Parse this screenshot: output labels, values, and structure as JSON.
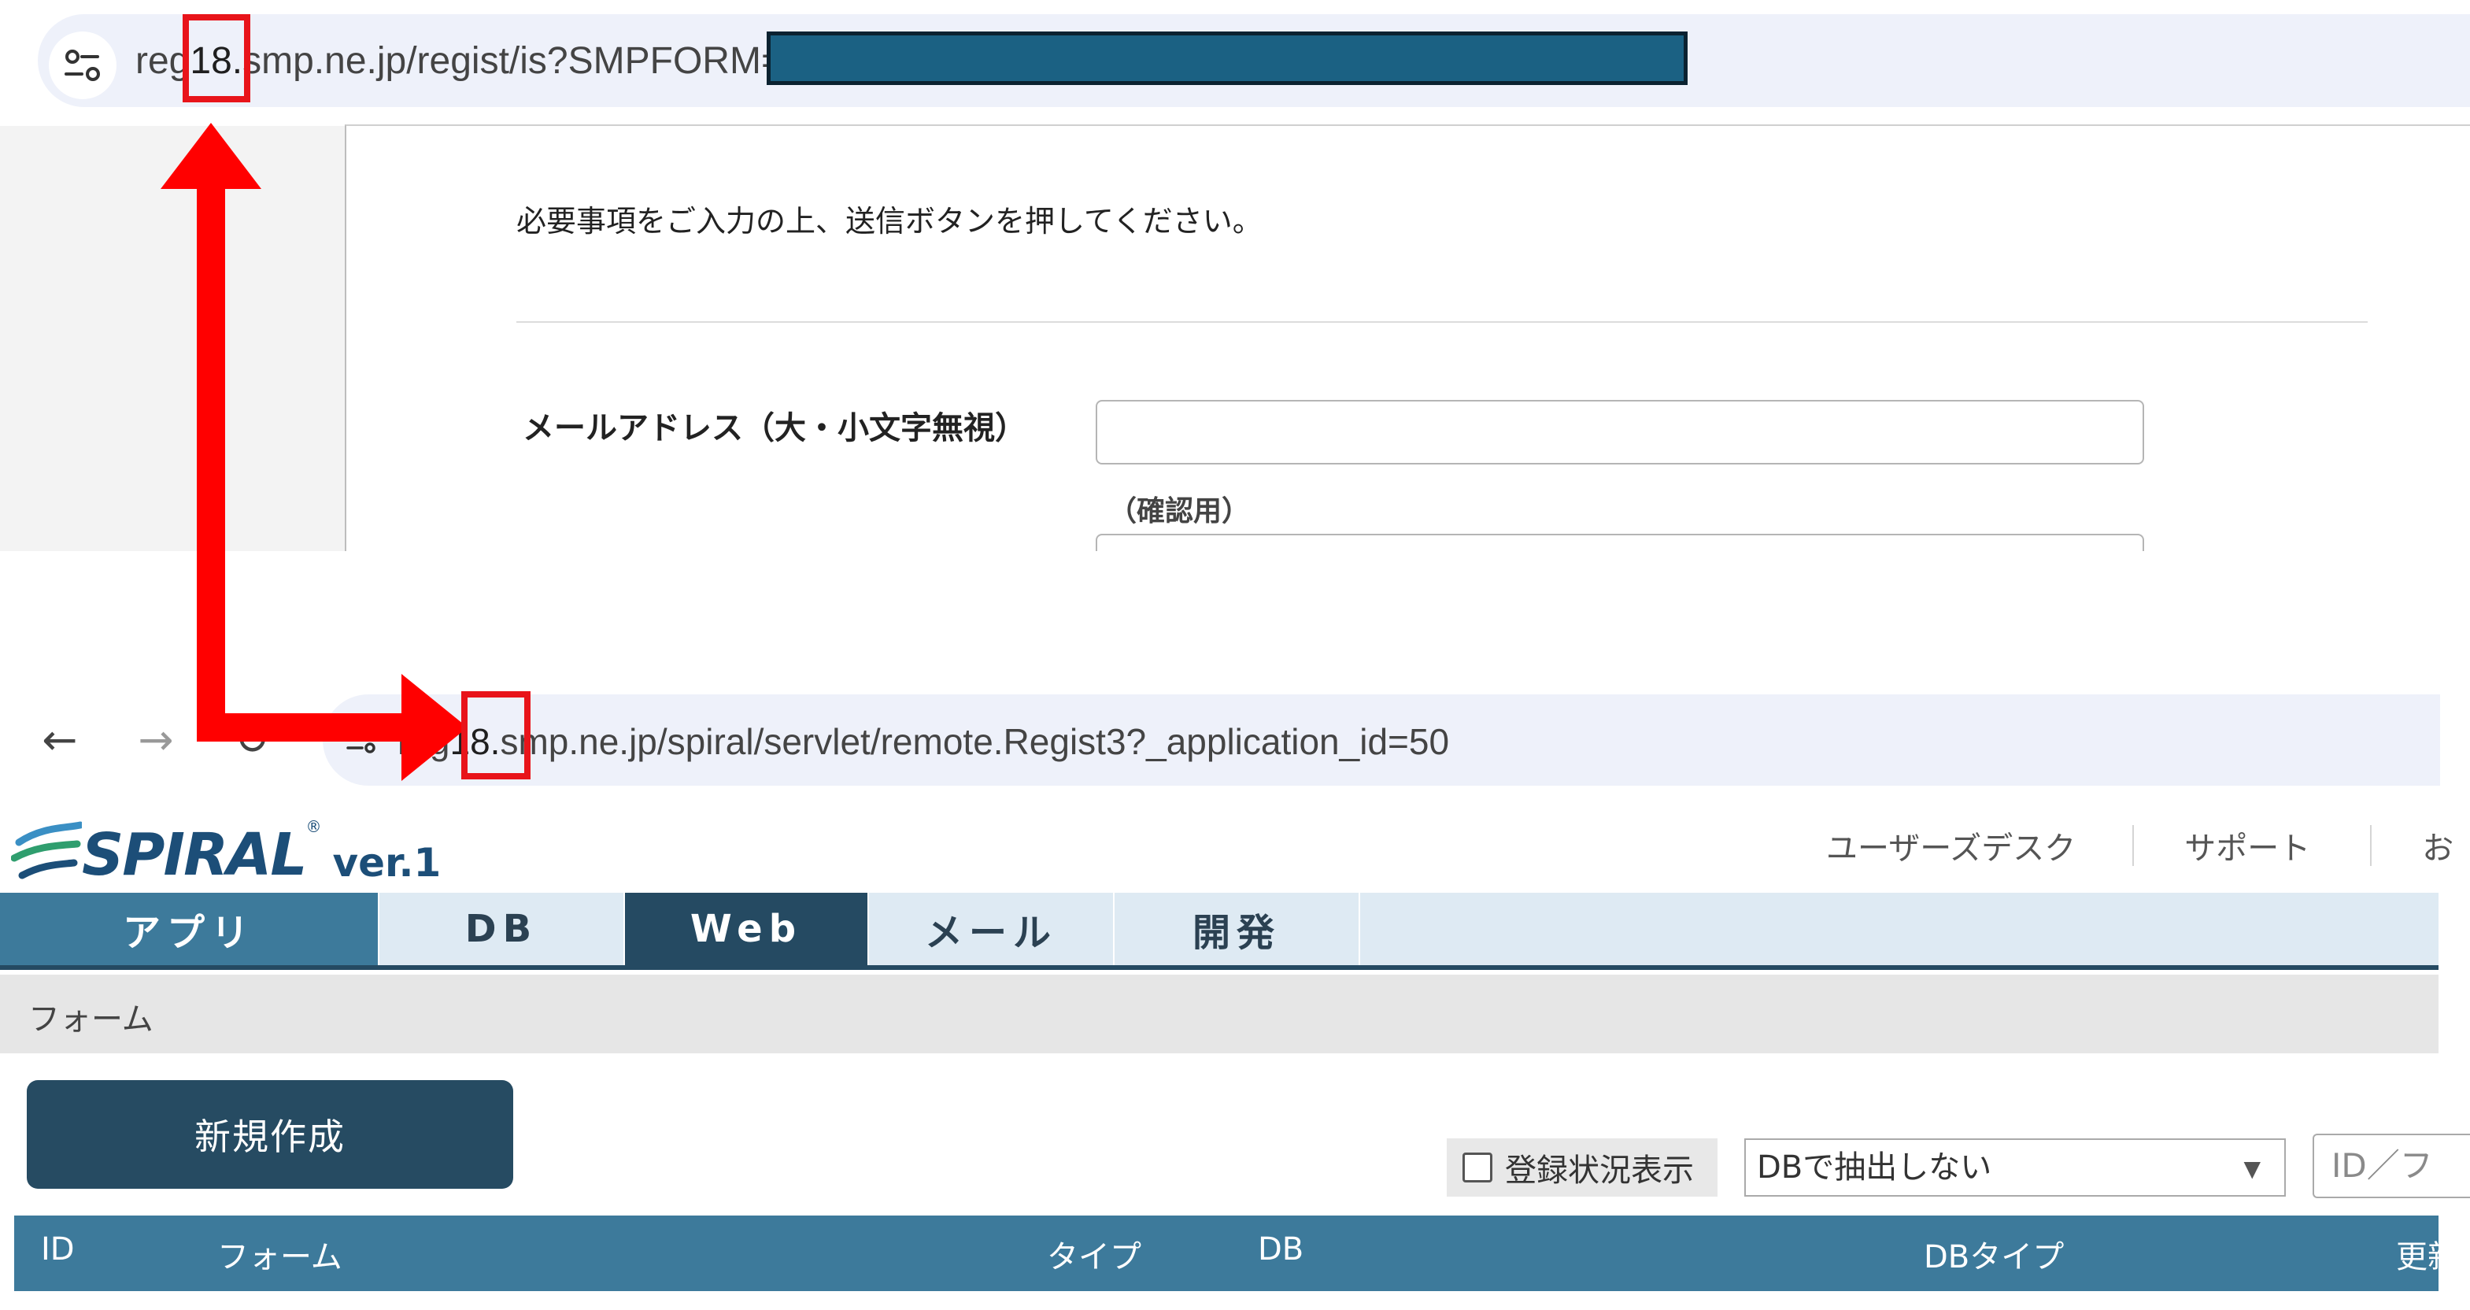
{
  "top_browser": {
    "url_prefix": "reg",
    "url_highlight": "18.",
    "url_rest": "smp.ne.jp/regist/is?SMPFORM="
  },
  "form": {
    "instructions": "必要事項をご入力の上、送信ボタンを押してください。",
    "email_label": "メールアドレス（大・小文字無視）",
    "confirm_label": "（確認用）"
  },
  "bottom_browser": {
    "back_icon": "←",
    "forward_icon": "→",
    "reload_icon": "↻",
    "url_prefix": "reg",
    "url_highlight": "18.",
    "url_rest": "smp.ne.jp/spiral/servlet/remote.Regist3?_application_id=50"
  },
  "app": {
    "logo_word": "SPIRAL",
    "logo_reg": "®",
    "logo_version": "ver.1",
    "top_links": [
      "ユーザーズデスク",
      "サポート",
      "お"
    ],
    "nav_tabs": [
      "アプリ",
      "DB",
      "Web",
      "メール",
      "開発"
    ],
    "breadcrumb": "フォーム",
    "new_button": "新規作成",
    "registration_toggle": "登録状況表示",
    "db_filter": "DBで抽出しない",
    "select_arrow": "▼",
    "id_search_placeholder": "ID／フ",
    "columns": [
      "ID",
      "フォーム",
      "タイプ",
      "DB",
      "DBタイプ",
      "更新"
    ]
  },
  "colors": {
    "annotation_red": "#e8141a",
    "nav_dark": "#254a62",
    "nav_mid": "#3d7a9b",
    "redacted": "#1b6183"
  }
}
